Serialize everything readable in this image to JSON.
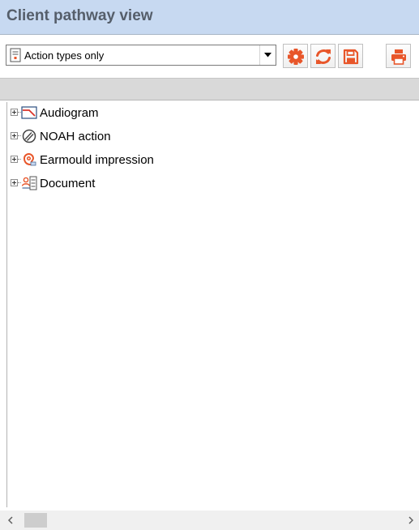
{
  "panel": {
    "title": "Client pathway view"
  },
  "filter": {
    "selected": "Action types only"
  },
  "toolbar": {
    "buttons": [
      {
        "icon": "settings-gear-icon"
      },
      {
        "icon": "refresh-icon"
      },
      {
        "icon": "save-icon"
      },
      {
        "icon": "print-icon"
      }
    ]
  },
  "colors": {
    "accent": "#e8562a",
    "title_bg": "#c7d9f1",
    "title_text": "#555e6a"
  },
  "tree": {
    "items": [
      {
        "label": "Audiogram",
        "icon": "audiogram-icon"
      },
      {
        "label": "NOAH action",
        "icon": "noah-icon"
      },
      {
        "label": "Earmould impression",
        "icon": "ear-impression-icon"
      },
      {
        "label": "Document",
        "icon": "document-icon"
      }
    ]
  }
}
